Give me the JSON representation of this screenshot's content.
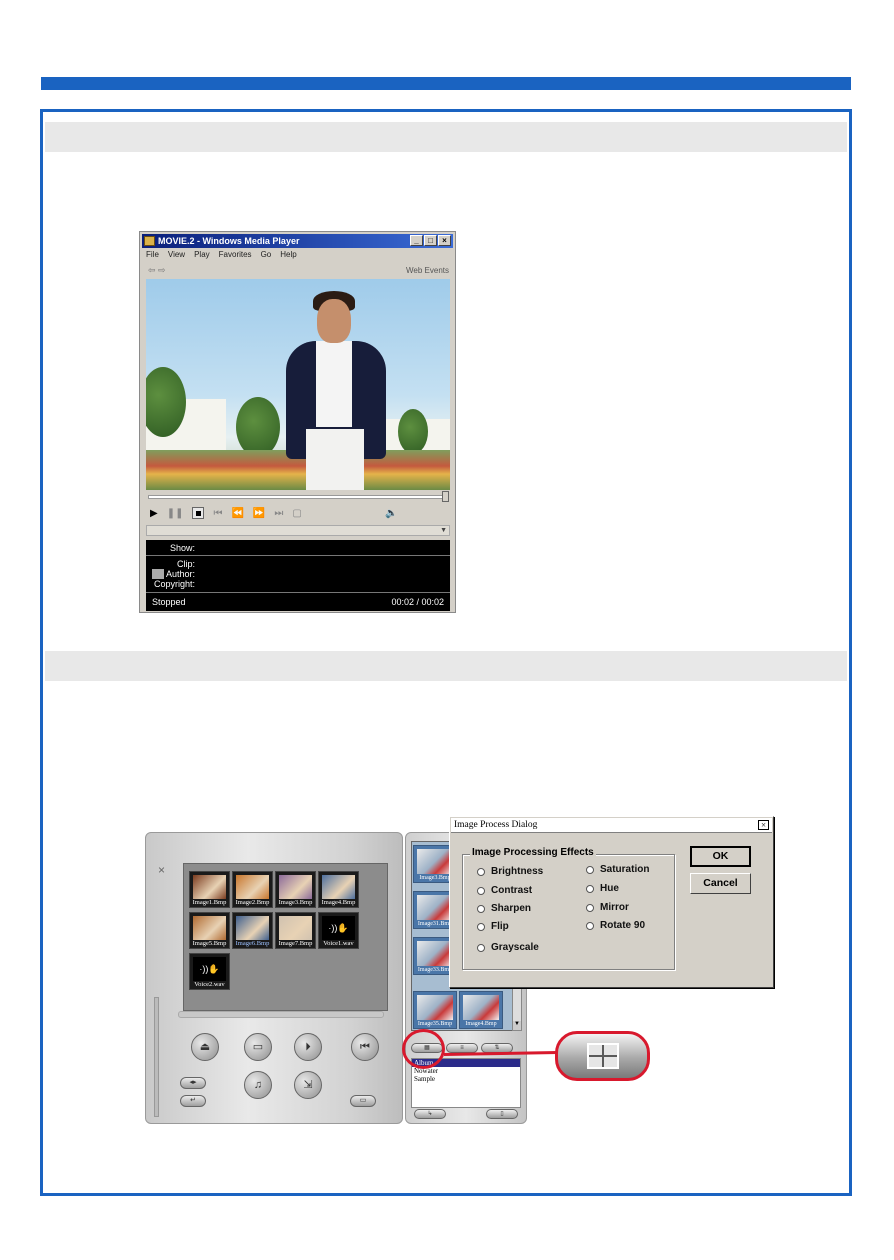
{
  "wmp": {
    "title": "MOVIE.2 - Windows Media Player",
    "window_buttons": [
      "_",
      "□",
      "×"
    ],
    "menu": [
      "File",
      "View",
      "Play",
      "Favorites",
      "Go",
      "Help"
    ],
    "nav": "⇦ ⇨",
    "web_events": "Web Events",
    "info": {
      "show": "Show:",
      "clip": "Clip:",
      "author": "Author:",
      "copyright": "Copyright:"
    },
    "status": "Stopped",
    "time": "00:02 / 00:02"
  },
  "album": {
    "thumbnails": [
      {
        "label": "Image1.Bmp",
        "color": "#7a3b1f"
      },
      {
        "label": "Image2.Bmp",
        "color": "#c7762c"
      },
      {
        "label": "Image3.Bmp",
        "color": "#8c6b9a"
      },
      {
        "label": "Image4.Bmp",
        "color": "#4d6f9e"
      },
      {
        "label": "Image5.Bmp",
        "color": "#b06a32"
      },
      {
        "label": "Image6.Bmp",
        "color": "#3e5f8e"
      },
      {
        "label": "Image7.Bmp",
        "color": "#d0c2b0"
      },
      {
        "label": "Voice1.wav",
        "color": "#000000"
      },
      {
        "label": "Voice2.wav",
        "color": "#000000"
      }
    ],
    "selected_index": 5
  },
  "sidepanel": {
    "list_items": [
      "Image3.Bmp",
      "Image31.Bmp",
      "Image33.Bmp",
      "Image35.Bmp",
      "Image4.Bmp"
    ],
    "albums": [
      "Album",
      "Nowater",
      "Sample"
    ]
  },
  "dialog": {
    "title": "Image Process Dialog",
    "close": "×",
    "group_title": "Image Processing Effects",
    "effects_left": [
      "Brightness",
      "Contrast",
      "Sharpen",
      "Flip",
      "Grayscale"
    ],
    "effects_right": [
      "Saturation",
      "Hue",
      "Mirror",
      "Rotate 90"
    ],
    "ok": "OK",
    "cancel": "Cancel"
  },
  "colors": {
    "accent": "#1a63c1",
    "highlight": "#d8192d"
  },
  "icons": {
    "highlighted_button": "grid-view-icon"
  }
}
